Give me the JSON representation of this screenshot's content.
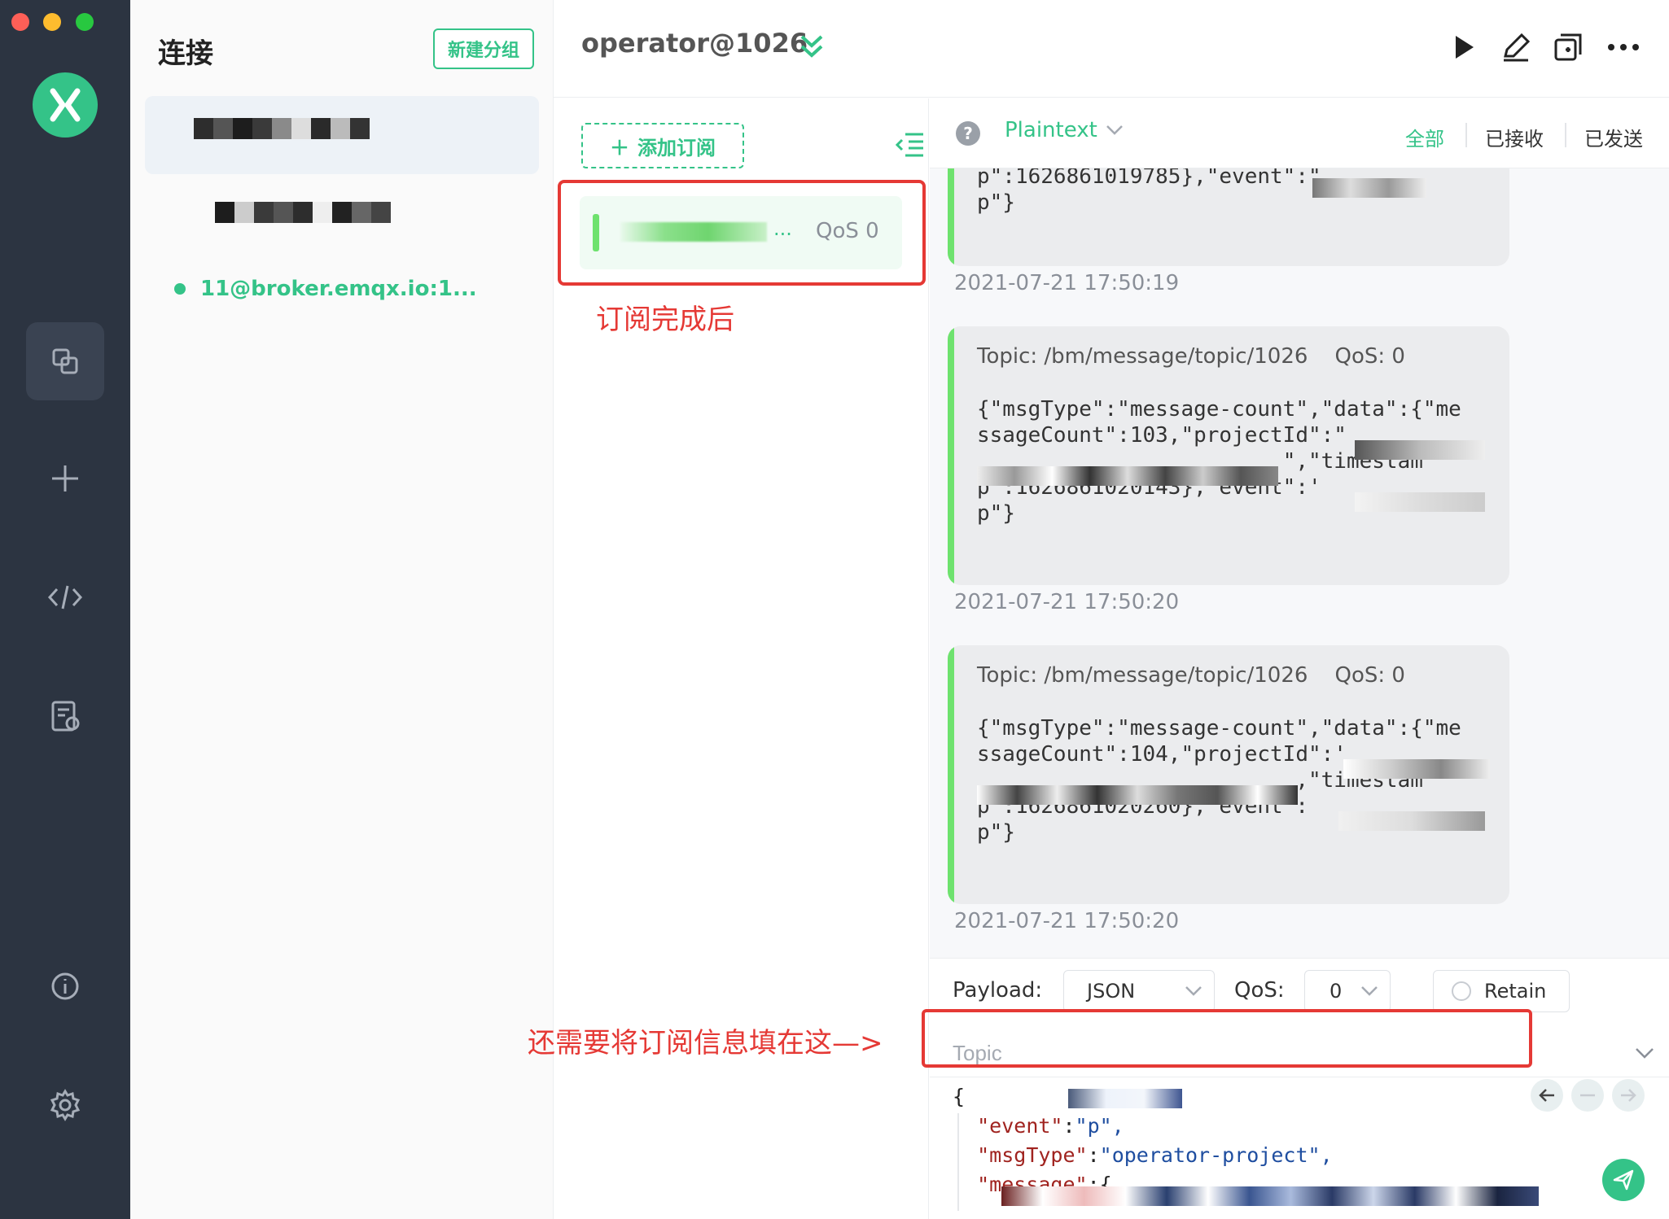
{
  "sidebar": {
    "title": "连接",
    "new_group_label": "新建分组",
    "connections": [
      {
        "label": ""
      },
      {
        "label": ""
      },
      {
        "label": "11@broker.emqx.io:1...",
        "status": "online"
      }
    ]
  },
  "header": {
    "connection_name": "operator@1026"
  },
  "subscriptions": {
    "add_label": "添加订阅",
    "items": [
      {
        "topic": "",
        "ellipsis": "...",
        "qos_label": "QoS 0",
        "color": "#6ee26e"
      }
    ]
  },
  "annotations": {
    "after_subscribe": "订阅完成后",
    "fill_topic": "还需要将订阅信息填在这—>"
  },
  "messages": {
    "format": "Plaintext",
    "filters": [
      "全部",
      "已接收",
      "已发送"
    ],
    "active_filter": "全部",
    "list": [
      {
        "body": [
          "p\":1626861019785},\"event\":\"",
          "p\"}"
        ],
        "time": "2021-07-21 17:50:19"
      },
      {
        "topic": "Topic: /bm/message/topic/1026",
        "qos": "QoS: 0",
        "body": [
          "{\"msgType\":\"message-count\",\"data\":{\"me",
          "ssageCount\":103,\"projectId\":\"",
          "\",\"timestam",
          "p\":1626861020143},\"event\":'",
          "p\"}"
        ],
        "time": "2021-07-21 17:50:20"
      },
      {
        "topic": "Topic: /bm/message/topic/1026",
        "qos": "QoS: 0",
        "body": [
          "{\"msgType\":\"message-count\",\"data\":{\"me",
          "ssageCount\":104,\"projectId\":'",
          ",\"timestam",
          "p\":1626861020260},\"event\":",
          "p\"}"
        ],
        "time": "2021-07-21 17:50:20"
      }
    ]
  },
  "publish": {
    "payload_label": "Payload:",
    "payload_format": "JSON",
    "qos_label": "QoS:",
    "qos_value": "0",
    "retain_label": "Retain",
    "topic_placeholder": "Topic",
    "payload_lines": {
      "open": "{",
      "event_key": "\"event\"",
      "event_val": "\"p\",",
      "msgtype_key": "\"msgType\"",
      "msgtype_val": "\"operator-project\",",
      "message_key": "\"message\"",
      "message_open": ":{"
    }
  },
  "colors": {
    "accent": "#34c388",
    "rail": "#2c3441",
    "annotation": "#e53935",
    "message_bar": "#6ee26e"
  }
}
